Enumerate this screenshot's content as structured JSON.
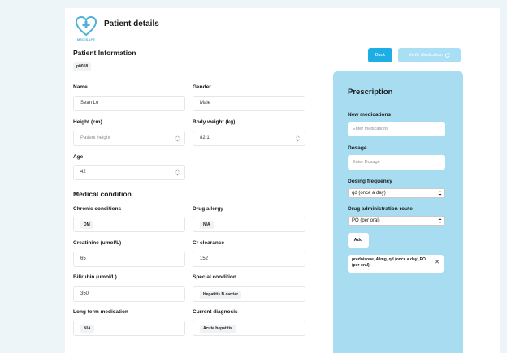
{
  "header": {
    "logo_text": "MEDISAFE",
    "title": "Patient details"
  },
  "actions": {
    "back_label": "Back",
    "verify_label": "Verify Medication"
  },
  "patient_info": {
    "section_title": "Patient Information",
    "patient_id": "p0018",
    "name": {
      "label": "Name",
      "value": "Sean Lo"
    },
    "gender": {
      "label": "Gender",
      "value": "Male"
    },
    "height": {
      "label": "Height (cm)",
      "placeholder": "Patient height"
    },
    "weight": {
      "label": "Body weight (kg)",
      "value": "82.1"
    },
    "age": {
      "label": "Age",
      "value": "42"
    }
  },
  "medical_condition": {
    "section_title": "Medical condition",
    "chronic": {
      "label": "Chronic conditions",
      "value": "DM"
    },
    "allergy": {
      "label": "Drug allergy",
      "value": "N/A"
    },
    "creatinine": {
      "label": "Creatinine (umol/L)",
      "value": "65"
    },
    "cr_clearance": {
      "label": "Cr clearance",
      "value": "152"
    },
    "bilirubin": {
      "label": "Bilirubin (umol/L)",
      "value": "350"
    },
    "special": {
      "label": "Special condition",
      "value": "Hepatitis B carrier"
    },
    "long_term": {
      "label": "Long term medication",
      "value": "N/A"
    },
    "diagnosis": {
      "label": "Current diagnosis",
      "value": "Acute hepatitis"
    }
  },
  "prescription": {
    "title": "Prescription",
    "new_med": {
      "label": "New medications",
      "placeholder": "Enter medications"
    },
    "dosage": {
      "label": "Dosage",
      "placeholder": "Enter Dosage"
    },
    "frequency": {
      "label": "Dosing frequency",
      "value": "qd (once a day)"
    },
    "route": {
      "label": "Drug administration route",
      "value": "PO (per oral)"
    },
    "add_label": "Add",
    "items": [
      {
        "text": "prednisone, 40mg, qd (once a day),PO (per oral)"
      }
    ]
  },
  "colors": {
    "accent": "#1eaee6",
    "accent_light": "#a8dff5",
    "panel_bg": "#a8dcf1"
  },
  "icons": [
    "heart-cross-logo-icon",
    "refresh-icon",
    "stepper-icon",
    "select-caret-icon",
    "close-icon"
  ]
}
